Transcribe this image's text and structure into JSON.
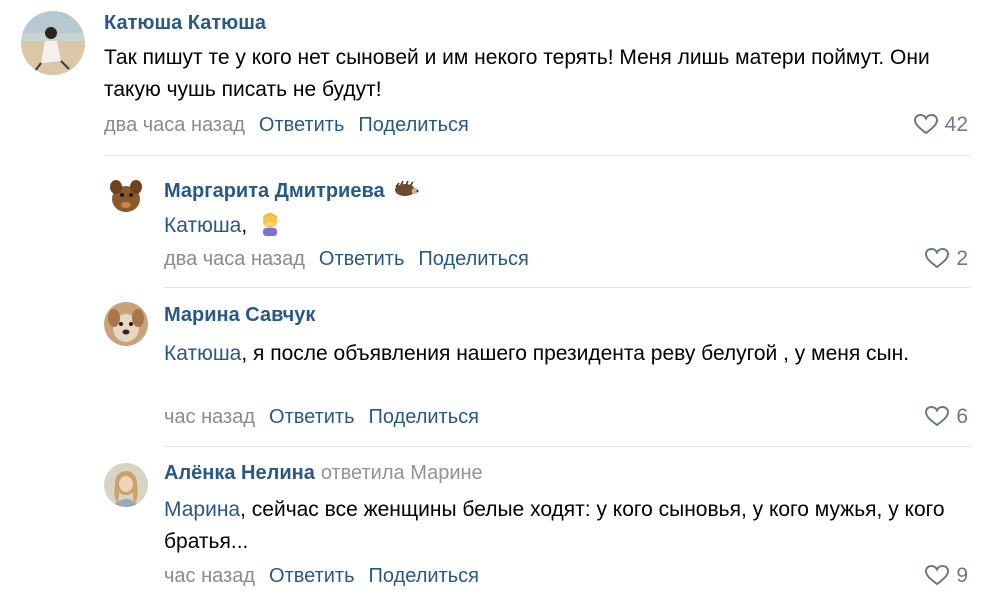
{
  "comments": [
    {
      "author": "Катюша Катюша",
      "reply_to": "",
      "mention": "",
      "text": "Так пишут те у кого нет сыновей и им некого терять! Меня лишь матери поймут. Они такую чушь писать не будут!",
      "time": "два часа назад",
      "reply_label": "Ответить",
      "share_label": "Поделиться",
      "likes": "42"
    },
    {
      "author": "Маргарита Дмитриева",
      "author_badge": "hedgehog-icon",
      "reply_to": "",
      "mention": "Катюша",
      "text": ",",
      "text_emoji": "person-facepalm-icon",
      "time": "два часа назад",
      "reply_label": "Ответить",
      "share_label": "Поделиться",
      "likes": "2"
    },
    {
      "author": "Марина Савчук",
      "reply_to": "",
      "mention": "Катюша",
      "text": ", я после объявления нашего президента реву белугой , у меня сын.",
      "time": "час назад",
      "reply_label": "Ответить",
      "share_label": "Поделиться",
      "likes": "6"
    },
    {
      "author": "Алёнка Нелина",
      "reply_to": "ответила Марине",
      "mention": "Марина",
      "text": ", сейчас все женщины белые ходят: у кого сыновья, у кого мужья, у кого братья...",
      "time": "час назад",
      "reply_label": "Ответить",
      "share_label": "Поделиться",
      "likes": "9"
    }
  ],
  "colors": {
    "link": "#2a5885",
    "muted": "#8a8a8a",
    "like_icon": "#6d7885",
    "divider": "#e2e4e8"
  }
}
